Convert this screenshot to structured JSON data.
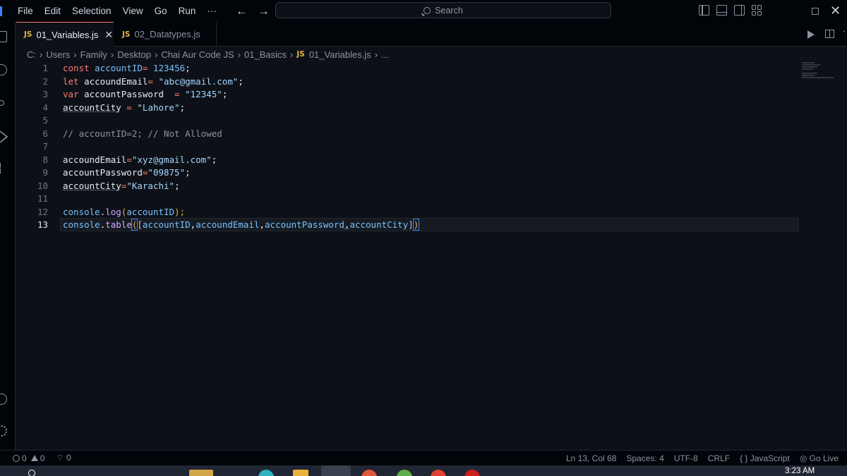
{
  "menu": [
    "File",
    "Edit",
    "Selection",
    "View",
    "Go",
    "Run",
    "···"
  ],
  "nav": {
    "back": "←",
    "forward": "→"
  },
  "search": {
    "placeholder": "Search"
  },
  "tabs": [
    {
      "badge": "JS",
      "label": "01_Variables.js",
      "close": "✕"
    },
    {
      "badge": "JS",
      "label": "02_Datatypes.js"
    }
  ],
  "breadcrumb": {
    "items": [
      "C:",
      "Users",
      "Family",
      "Desktop",
      "Chai Aur Code JS",
      "01_Basics"
    ],
    "file_badge": "JS",
    "file": "01_Variables.js",
    "tail": "..."
  },
  "code": {
    "line_numbers": [
      "1",
      "2",
      "3",
      "4",
      "5",
      "6",
      "7",
      "8",
      "9",
      "10",
      "11",
      "12",
      "13"
    ],
    "active_line": "13",
    "l1": {
      "kw": "const",
      "id": "accountID",
      "eq": "=",
      "val": "123456",
      "end": ";"
    },
    "l2": {
      "kw": "let",
      "id": "accoundEmail",
      "eq": "=",
      "val": "\"abc@gmail.com\"",
      "end": ";"
    },
    "l3": {
      "kw": "var",
      "id": "accountPassword",
      "eq": "=",
      "val": "\"12345\"",
      "end": ";"
    },
    "l4": {
      "id": "accountCity",
      "eq": "=",
      "val": "\"Lahore\"",
      "end": ";"
    },
    "l6": {
      "comment": "// accountID=2; // Not Allowed"
    },
    "l8": {
      "id": "accoundEmail",
      "eq": "=",
      "val": "\"xyz@gmail.com\"",
      "end": ";"
    },
    "l9": {
      "id": "accountPassword",
      "eq": "=",
      "val": "\"09875\"",
      "end": ";"
    },
    "l10": {
      "id": "accountCity",
      "eq": "=",
      "val": "\"Karachi\"",
      "end": ";"
    },
    "l12": {
      "obj": "console",
      "dot": ".",
      "fn": "log",
      "open": "(",
      "arg": "accountID",
      "close": ");"
    },
    "l13": {
      "obj": "console",
      "dot": ".",
      "fn": "table",
      "open": "(",
      "bopen": "[",
      "a1": "accountID",
      "a2": "accoundEmail",
      "a3": "accountPassword",
      "a4": "accountCity",
      "comma": ",",
      "bclose": "]",
      "close": ")"
    }
  },
  "status": {
    "errors": "0",
    "warnings": "0",
    "ports": "0",
    "position": "Ln 13, Col 68",
    "spaces": "Spaces: 4",
    "encoding": "UTF-8",
    "eol": "CRLF",
    "language_icon": "{ }",
    "language": "JavaScript",
    "live": "Go Live"
  },
  "taskbar": {
    "time": "3:23 AM"
  },
  "colors": {
    "keyword": "#ff7b72",
    "constant": "#79c0ff",
    "string": "#a5d6ff",
    "comment": "#8b949e",
    "function": "#d2a8ff",
    "tab_accent": "#f78166",
    "js_badge": "#e3b341"
  }
}
